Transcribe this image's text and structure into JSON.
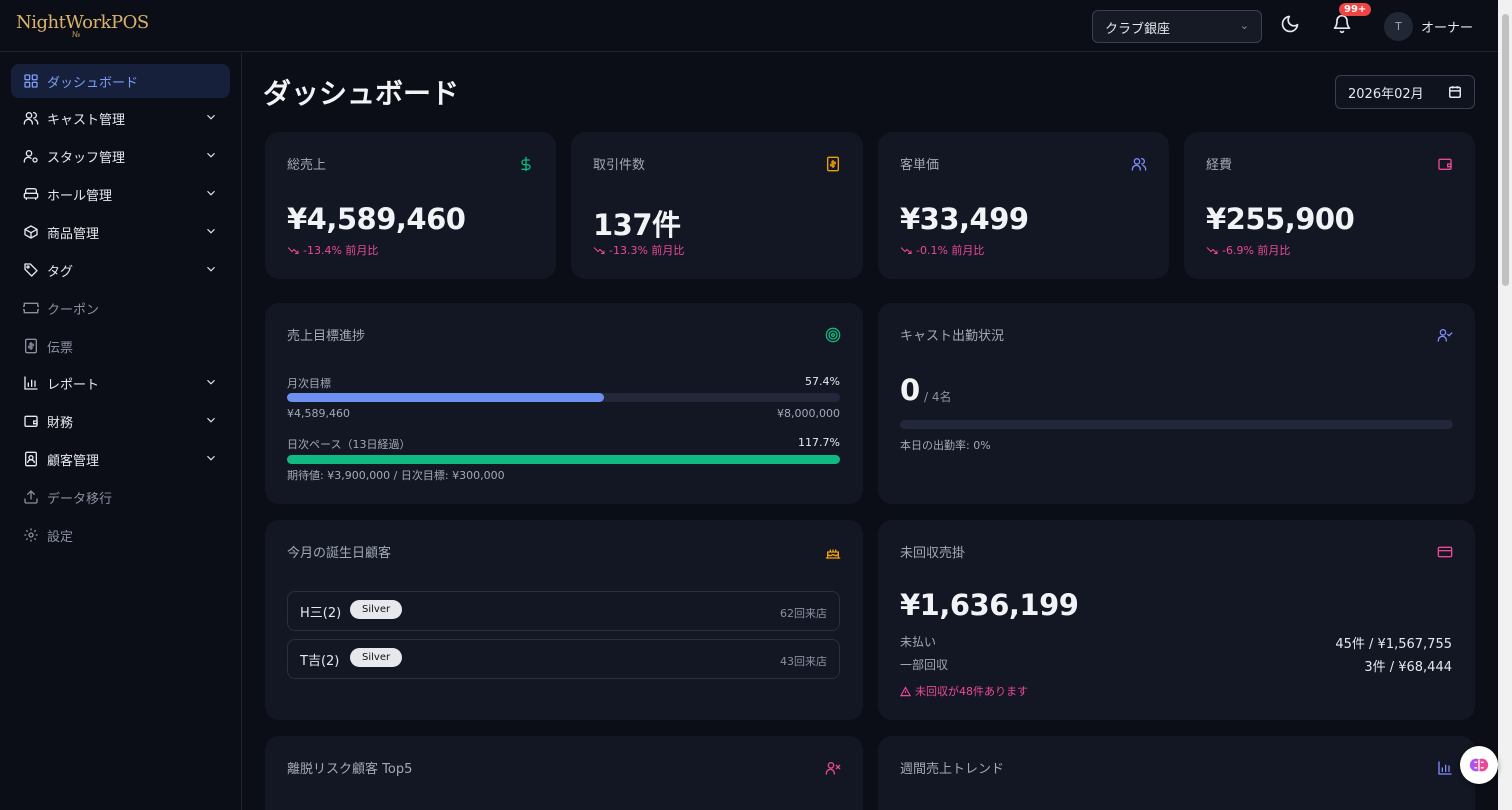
{
  "app": {
    "logo": "NightWorkPOS",
    "logo_sub": "№"
  },
  "header": {
    "store": "クラブ銀座",
    "notification_badge": "99+",
    "avatar_initial": "T",
    "user_name": "オーナー"
  },
  "sidebar": {
    "items": [
      {
        "label": "ダッシュボード",
        "icon": "dashboard-grid-icon",
        "expandable": false,
        "active": true
      },
      {
        "label": "キャスト管理",
        "icon": "users-icon",
        "expandable": true
      },
      {
        "label": "スタッフ管理",
        "icon": "user-cog-icon",
        "expandable": true
      },
      {
        "label": "ホール管理",
        "icon": "sofa-icon",
        "expandable": true
      },
      {
        "label": "商品管理",
        "icon": "package-icon",
        "expandable": true
      },
      {
        "label": "タグ",
        "icon": "tag-icon",
        "expandable": true
      },
      {
        "label": "クーポン",
        "icon": "ticket-icon",
        "expandable": false,
        "muted": true
      },
      {
        "label": "伝票",
        "icon": "receipt-icon",
        "expandable": false,
        "muted": true
      },
      {
        "label": "レポート",
        "icon": "bar-chart-icon",
        "expandable": true
      },
      {
        "label": "財務",
        "icon": "wallet-icon",
        "expandable": true
      },
      {
        "label": "顧客管理",
        "icon": "contact-icon",
        "expandable": true
      },
      {
        "label": "データ移行",
        "icon": "upload-icon",
        "expandable": false,
        "muted": true
      },
      {
        "label": "設定",
        "icon": "gear-icon",
        "expandable": false,
        "muted": true
      }
    ]
  },
  "main": {
    "title": "ダッシュボード",
    "month": "2026年02月",
    "kpis": [
      {
        "title": "総売上",
        "value": "¥4,589,460",
        "change": "-13.4% 前月比",
        "icon": "dollar-icon",
        "color": "#10b981"
      },
      {
        "title": "取引件数",
        "value": "137件",
        "change": "-13.3% 前月比",
        "icon": "receipt-icon",
        "color": "#f59e0b"
      },
      {
        "title": "客単価",
        "value": "¥33,499",
        "change": "-0.1% 前月比",
        "icon": "users-icon",
        "color": "#818cf8"
      },
      {
        "title": "経費",
        "value": "¥255,900",
        "change": "-6.9% 前月比",
        "icon": "wallet-icon",
        "color": "#ec4899"
      }
    ],
    "goal": {
      "title": "売上目標進捗",
      "monthly_label": "月次目標",
      "monthly_pct": "57.4%",
      "monthly_progress": 0.574,
      "monthly_current": "¥4,589,460",
      "monthly_target": "¥8,000,000",
      "daily_label": "日次ペース（13日経過）",
      "daily_pct": "117.7%",
      "daily_progress": 1.0,
      "daily_note": "期待値: ¥3,900,000 / 日次目標: ¥300,000"
    },
    "attendance": {
      "title": "キャスト出勤状況",
      "count": "0",
      "total": "/ 4名",
      "progress": 0,
      "rate": "本日の出勤率: 0%"
    },
    "birthdays": {
      "title": "今月の誕生日顧客",
      "rows": [
        {
          "name": "H三(2)",
          "tier": "Silver",
          "visits": "62回来店"
        },
        {
          "name": "T吉(2)",
          "tier": "Silver",
          "visits": "43回来店"
        }
      ]
    },
    "receivables": {
      "title": "未回収売掛",
      "total": "¥1,636,199",
      "unpaid_label": "未払い",
      "unpaid_value": "45件 / ¥1,567,755",
      "partial_label": "一部回収",
      "partial_value": "3件 / ¥68,444",
      "warning": "未回収が48件あります"
    },
    "churn": {
      "title": "離脱リスク顧客 Top5"
    },
    "weekly": {
      "title": "週間売上トレンド"
    }
  },
  "colors": {
    "accent": "#7c9cf5",
    "goal_bar": "#6d8ff0",
    "pace_bar": "#10b981",
    "negative": "#ec4899"
  }
}
